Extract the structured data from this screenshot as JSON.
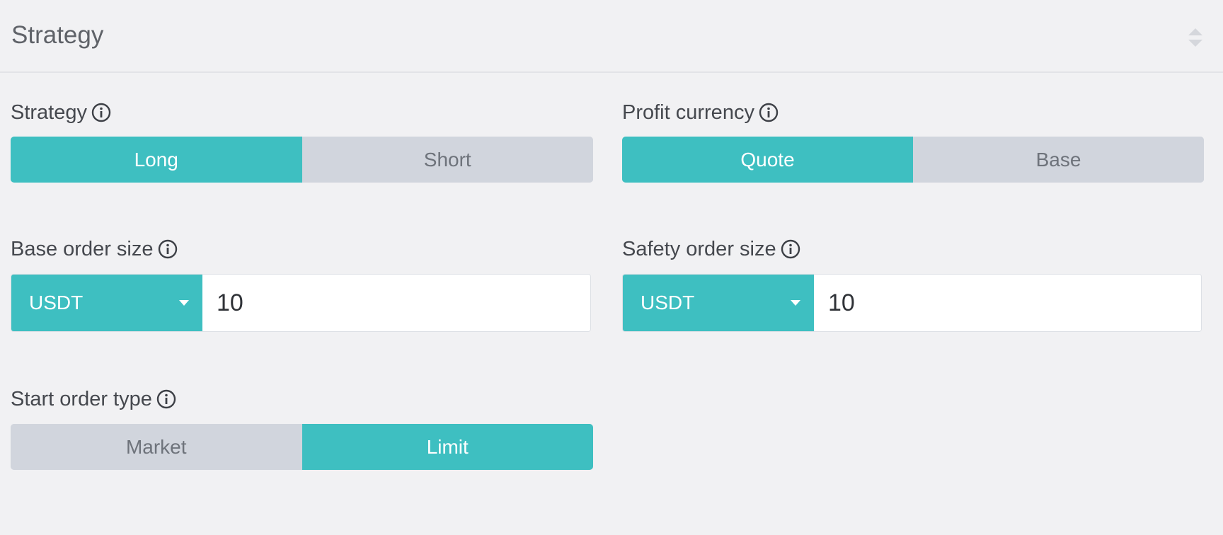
{
  "header": {
    "title": "Strategy"
  },
  "strategy": {
    "label": "Strategy",
    "options": [
      "Long",
      "Short"
    ],
    "selected": "Long"
  },
  "profit_currency": {
    "label": "Profit currency",
    "options": [
      "Quote",
      "Base"
    ],
    "selected": "Quote"
  },
  "base_order_size": {
    "label": "Base order size",
    "currency": "USDT",
    "value": "10"
  },
  "safety_order_size": {
    "label": "Safety order size",
    "currency": "USDT",
    "value": "10"
  },
  "start_order_type": {
    "label": "Start order type",
    "options": [
      "Market",
      "Limit"
    ],
    "selected": "Limit"
  },
  "colors": {
    "accent": "#3ebfc1",
    "inactive": "#d1d5dd",
    "background": "#f1f1f3"
  },
  "icons": [
    "sort-icon",
    "info-icon",
    "caret-down-icon"
  ]
}
